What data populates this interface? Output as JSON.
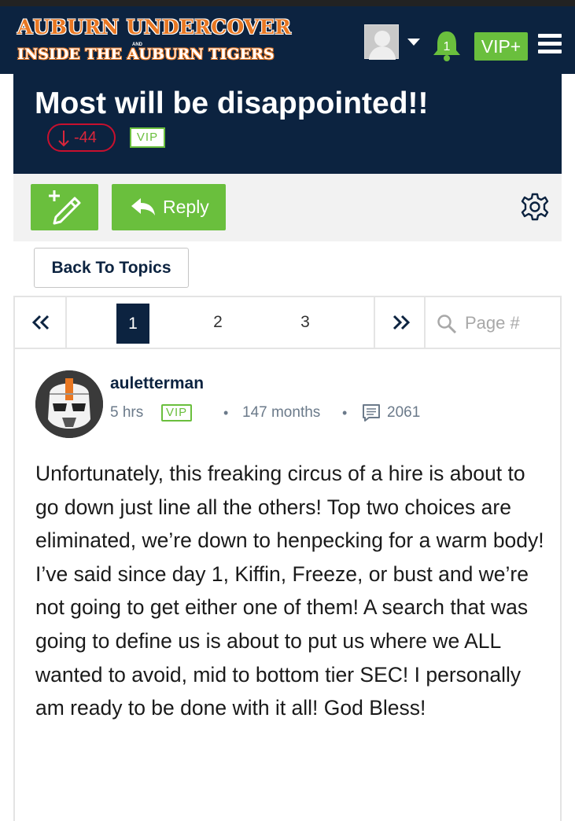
{
  "header": {
    "logo_line1": "AUBURN UNDERCOVER",
    "logo_and": "AND",
    "logo_line2": "INSIDE THE AUBURN TIGERS",
    "notification_count": "1",
    "vip_label": "VIP+"
  },
  "topic": {
    "title": "Most will be disappointed!!",
    "vote_score": "-44",
    "vip_badge": "VIP"
  },
  "toolbar": {
    "reply_label": "Reply",
    "back_label": "Back To Topics"
  },
  "pagination": {
    "pages": [
      "1",
      "2",
      "3"
    ],
    "current_page": "1",
    "page_placeholder": "Page #"
  },
  "post": {
    "username": "auletterman",
    "time": "5 hrs",
    "vip_badge": "VIP",
    "tenure": "147 months",
    "post_count": "2061",
    "body": "Unfortunately, this freaking circus of a hire is about to go down just line all the others! Top two choices are eliminated, we’re down to henpecking for a warm body! I’ve said since day 1, Kiffin, Freeze, or bust and we’re not going to get either one of them! A search that was going to define us is about to put us where we ALL wanted to avoid, mid to bottom tier SEC! I personally am ready to be done with it all! God Bless!"
  },
  "colors": {
    "navy": "#0c2340",
    "orange": "#e87722",
    "green": "#6abf3d",
    "red": "#c8102e"
  },
  "icons": [
    "user-avatar-icon",
    "dropdown-caret-icon",
    "bell-icon",
    "hamburger-menu-icon",
    "new-topic-pencil-icon",
    "reply-arrow-icon",
    "gear-icon",
    "double-chevron-left-icon",
    "double-chevron-right-icon",
    "search-icon",
    "posts-count-icon",
    "down-arrow-icon"
  ]
}
